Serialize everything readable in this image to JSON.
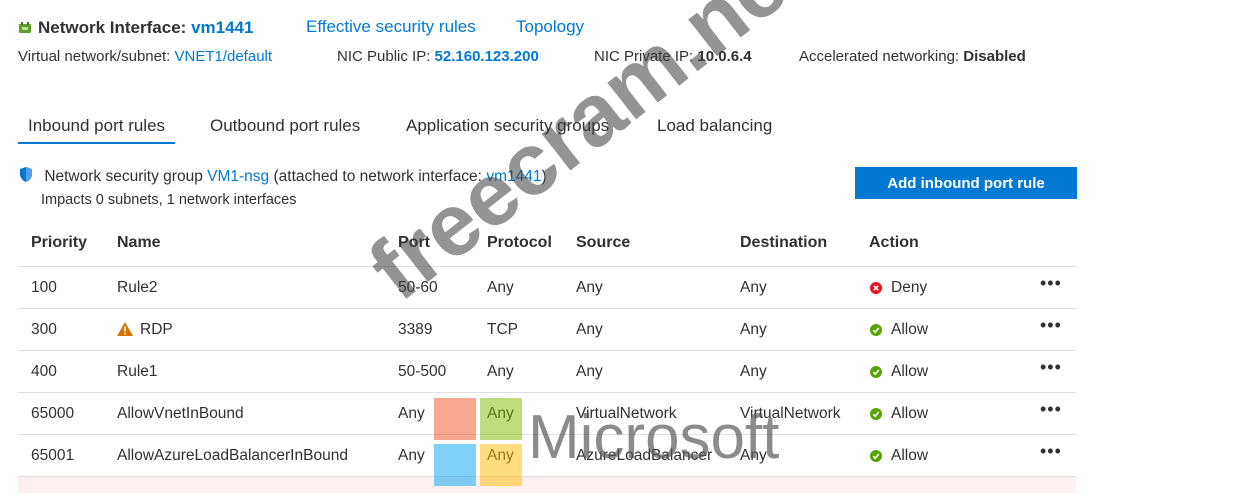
{
  "header": {
    "title_prefix": "Network Interface:",
    "vm_name": "vm1441",
    "links": [
      "Effective security rules",
      "Topology"
    ]
  },
  "info": {
    "vnet_label": "Virtual network/subnet:",
    "vnet_value": "VNET1/default",
    "public_ip_label": "NIC Public IP:",
    "public_ip_value": "52.160.123.200",
    "private_ip_label": "NIC Private IP:",
    "private_ip_value": "10.0.6.4",
    "accel_label": "Accelerated networking:",
    "accel_value": "Disabled"
  },
  "tabs": [
    {
      "label": "Inbound port rules",
      "active": true
    },
    {
      "label": "Outbound port rules",
      "active": false
    },
    {
      "label": "Application security groups",
      "active": false
    },
    {
      "label": "Load balancing",
      "active": false
    }
  ],
  "nsg": {
    "prefix": "Network security group",
    "name": "VM1-nsg",
    "middle": "(attached to network interface:",
    "nic": "vm1441",
    "suffix": ")",
    "impacts": "Impacts 0 subnets, 1 network interfaces",
    "add_button": "Add inbound port rule"
  },
  "table": {
    "columns": [
      "Priority",
      "Name",
      "Port",
      "Protocol",
      "Source",
      "Destination",
      "Action"
    ],
    "rows": [
      {
        "priority": "100",
        "name": "Rule2",
        "warning": false,
        "port": "50-60",
        "protocol": "Any",
        "source": "Any",
        "destination": "Any",
        "action": "Deny"
      },
      {
        "priority": "300",
        "name": "RDP",
        "warning": true,
        "port": "3389",
        "protocol": "TCP",
        "source": "Any",
        "destination": "Any",
        "action": "Allow"
      },
      {
        "priority": "400",
        "name": "Rule1",
        "warning": false,
        "port": "50-500",
        "protocol": "Any",
        "source": "Any",
        "destination": "Any",
        "action": "Allow"
      },
      {
        "priority": "65000",
        "name": "AllowVnetInBound",
        "warning": false,
        "port": "Any",
        "protocol": "Any",
        "source": "VirtualNetwork",
        "destination": "VirtualNetwork",
        "action": "Allow"
      },
      {
        "priority": "65001",
        "name": "AllowAzureLoadBalancerInBound",
        "warning": false,
        "port": "Any",
        "protocol": "Any",
        "source": "AzureLoadBalancer",
        "destination": "Any",
        "action": "Allow"
      }
    ],
    "more_label": "•••"
  },
  "watermark": {
    "text": "freecram.net",
    "logo_text": "Microsoft"
  },
  "colors": {
    "accent": "#0078d4",
    "allow": "#57a300",
    "deny": "#e81123",
    "warning": "#d47500",
    "ms_red": "#f25022",
    "ms_green": "#7fba00",
    "ms_blue": "#00a4ef",
    "ms_yellow": "#ffb900"
  }
}
